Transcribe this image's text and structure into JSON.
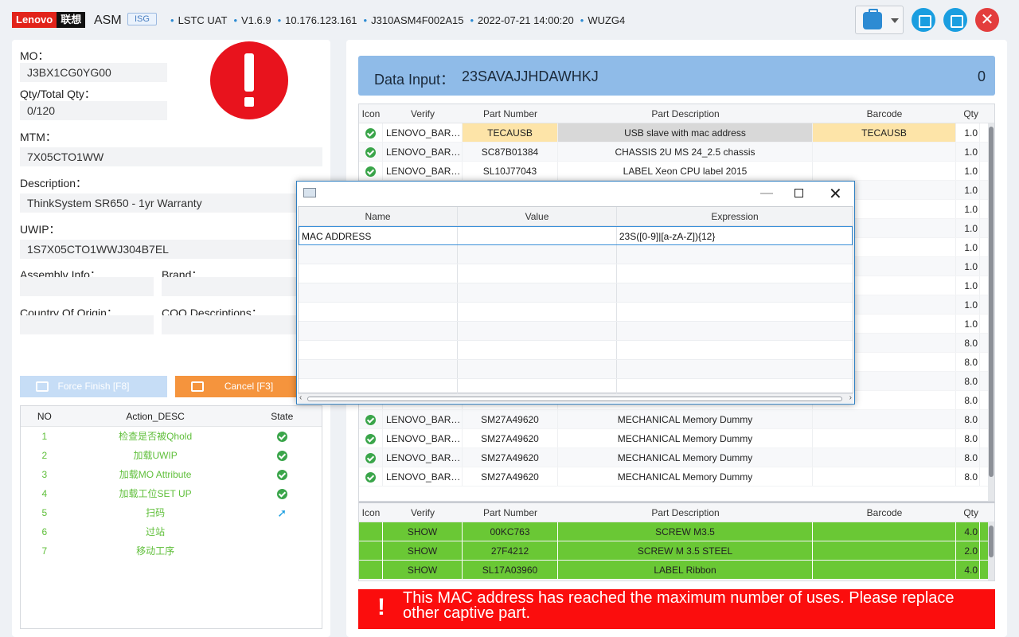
{
  "header": {
    "logo_en": "Lenovo",
    "logo_cn": "联想",
    "app_name": "ASM",
    "badge": "ISG",
    "meta": [
      "LSTC UAT",
      "V1.6.9",
      "10.176.123.161",
      "J310ASM4F002A15",
      "2022-07-21 14:00:20",
      "WUZG4"
    ],
    "accent_color": "#1a9ee0"
  },
  "left": {
    "mo_label": "MO：",
    "mo_value": "J3BX1CG0YG00",
    "qty_label": "Qty/Total Qty：",
    "qty_value": "0/120",
    "mtm_label": "MTM：",
    "mtm_value": "7X05CTO1WW",
    "desc_label": "Description：",
    "desc_value": "ThinkSystem SR650 - 1yr Warranty",
    "uwip_label": "UWIP：",
    "uwip_value": "1S7X05CTO1WWJ304B7EL",
    "assembly_label": "Assembly Info：",
    "brand_label": "Brand：",
    "coo_label": "Country Of Origin：",
    "coo_desc_label": "COO Descriptions：",
    "force_finish": "Force Finish [F8]",
    "cancel": "Cancel [F3]",
    "action_headers": {
      "no": "NO",
      "desc": "Action_DESC",
      "state": "State"
    },
    "actions": [
      {
        "no": "1",
        "desc": "检查是否被Qhold",
        "state": "ok"
      },
      {
        "no": "2",
        "desc": "加载UWIP",
        "state": "ok"
      },
      {
        "no": "3",
        "desc": "加载MO Attribute",
        "state": "ok"
      },
      {
        "no": "4",
        "desc": "加载工位SET UP",
        "state": "ok"
      },
      {
        "no": "5",
        "desc": "扫码",
        "state": "running"
      },
      {
        "no": "6",
        "desc": "过站",
        "state": ""
      },
      {
        "no": "7",
        "desc": "移动工序",
        "state": ""
      }
    ]
  },
  "right": {
    "data_input_label": "Data Input：",
    "data_input_value": "23SAVAJJHDAWHKJ",
    "data_input_count": "0",
    "grid_headers": {
      "icon": "Icon",
      "verify": "Verify",
      "part": "Part Number",
      "desc": "Part Description",
      "barcode": "Barcode",
      "qty": "Qty"
    },
    "grid_rows": [
      {
        "verify": "LENOVO_BARC...",
        "part": "TECAUSB",
        "desc": "USB slave with mac address",
        "barcode": "TECAUSB",
        "qty": "1.0"
      },
      {
        "verify": "LENOVO_BARC...",
        "part": "SC87B01384",
        "desc": "CHASSIS 2U MS 24_2.5 chassis",
        "barcode": "",
        "qty": "1.0"
      },
      {
        "verify": "LENOVO_BARC...",
        "part": "SL10J77043",
        "desc": "LABEL Xeon CPU label 2015",
        "barcode": "",
        "qty": "1.0"
      },
      {
        "verify": "",
        "part": "",
        "desc": "",
        "barcode": "",
        "qty": "1.0"
      },
      {
        "verify": "",
        "part": "",
        "desc": "",
        "barcode": "",
        "qty": "1.0"
      },
      {
        "verify": "",
        "part": "",
        "desc": "",
        "barcode": "",
        "qty": "1.0"
      },
      {
        "verify": "",
        "part": "",
        "desc": "",
        "barcode": "",
        "qty": "1.0"
      },
      {
        "verify": "",
        "part": "",
        "desc": "",
        "barcode": "",
        "qty": "1.0"
      },
      {
        "verify": "",
        "part": "",
        "desc": "",
        "barcode": "",
        "qty": "1.0"
      },
      {
        "verify": "",
        "part": "",
        "desc": "",
        "barcode": "",
        "qty": "1.0"
      },
      {
        "verify": "",
        "part": "",
        "desc": "",
        "barcode": "",
        "qty": "1.0"
      },
      {
        "verify": "",
        "part": "",
        "desc": "",
        "barcode": "",
        "qty": "8.0"
      },
      {
        "verify": "",
        "part": "",
        "desc": "",
        "barcode": "",
        "qty": "8.0"
      },
      {
        "verify": "",
        "part": "",
        "desc": "",
        "barcode": "",
        "qty": "8.0"
      },
      {
        "verify": "",
        "part": "",
        "desc": "",
        "barcode": "",
        "qty": "8.0"
      },
      {
        "verify": "LENOVO_BARC...",
        "part": "SM27A49620",
        "desc": "MECHANICAL Memory Dummy",
        "barcode": "",
        "qty": "8.0"
      },
      {
        "verify": "LENOVO_BARC...",
        "part": "SM27A49620",
        "desc": "MECHANICAL Memory Dummy",
        "barcode": "",
        "qty": "8.0"
      },
      {
        "verify": "LENOVO_BARC...",
        "part": "SM27A49620",
        "desc": "MECHANICAL Memory Dummy",
        "barcode": "",
        "qty": "8.0"
      },
      {
        "verify": "LENOVO_BARC...",
        "part": "SM27A49620",
        "desc": "MECHANICAL Memory Dummy",
        "barcode": "",
        "qty": "8.0"
      }
    ],
    "grid2_rows": [
      {
        "verify": "SHOW",
        "part": "00KC763",
        "desc": "SCREW M3.5",
        "barcode": "",
        "qty": "4.0"
      },
      {
        "verify": "SHOW",
        "part": "27F4212",
        "desc": "SCREW M 3.5 STEEL",
        "barcode": "",
        "qty": "2.0"
      },
      {
        "verify": "SHOW",
        "part": "SL17A03960",
        "desc": "LABEL Ribbon",
        "barcode": "",
        "qty": "4.0"
      }
    ],
    "alert_message": "This MAC address has reached the maximum number of uses. Please replace other captive part.",
    "alert_color": "#fb0d0d"
  },
  "dialog": {
    "headers": {
      "name": "Name",
      "value": "Value",
      "expression": "Expression"
    },
    "rows": [
      {
        "name": "MAC ADDRESS",
        "value": "",
        "expression": "23S([0-9]|[a-zA-Z]){12}"
      }
    ],
    "empty_rows": 8
  }
}
